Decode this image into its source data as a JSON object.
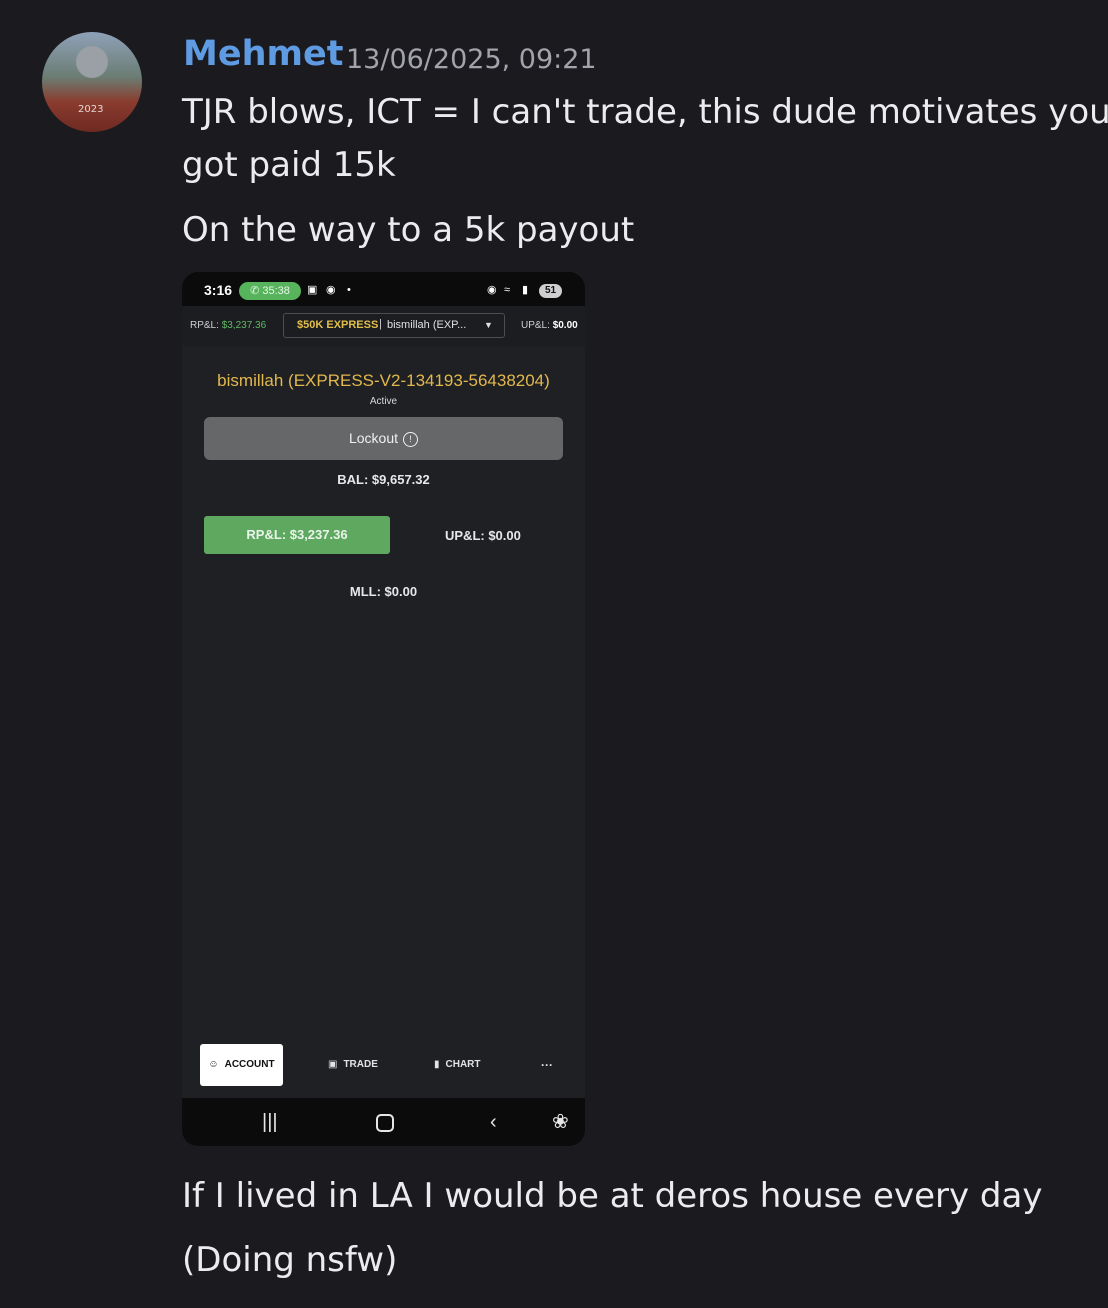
{
  "message": {
    "username": "Mehmet",
    "timestamp": "13/06/2025, 09:21",
    "avatar_text": "2023",
    "lines": [
      "TJR blows, ICT = I can't trade, this dude motivates you, I",
      "got paid 15k",
      "On the way to a 5k payout",
      "If I lived in LA I would be at deros house every day",
      "(Doing nsfw)"
    ]
  },
  "phone": {
    "status": {
      "time": "3:16",
      "call_timer": "35:38",
      "battery": "51",
      "call_icon": "phone-icon",
      "screen_icon": "screenshot-icon",
      "location_icon": "location-pin-icon",
      "wifi_icon": "wifi-icon",
      "signal_icon": "signal-icon"
    },
    "topbar": {
      "rpl_label": "RP&L:",
      "rpl_value": "$3,237.36",
      "plan": "$50K EXPRESS",
      "separator": "|",
      "account_short": "bismillah (EXP...",
      "upl_label": "UP&L:",
      "upl_value": "$0.00"
    },
    "account": {
      "name": "bismillah (EXPRESS-V2-134193-56438204)",
      "status": "Active",
      "lockout_label": "Lockout",
      "balance": "BAL: $9,657.32",
      "rpl": "RP&L: $3,237.36",
      "upl": "UP&L: $0.00",
      "mll": "MLL: $0.00"
    },
    "tabs": {
      "account": "ACCOUNT",
      "trade": "TRADE",
      "chart": "CHART",
      "more": "···"
    },
    "colors": {
      "username": "#5e9be3",
      "profit_green": "#5ea85f",
      "account_gold": "#e2b84d"
    }
  }
}
